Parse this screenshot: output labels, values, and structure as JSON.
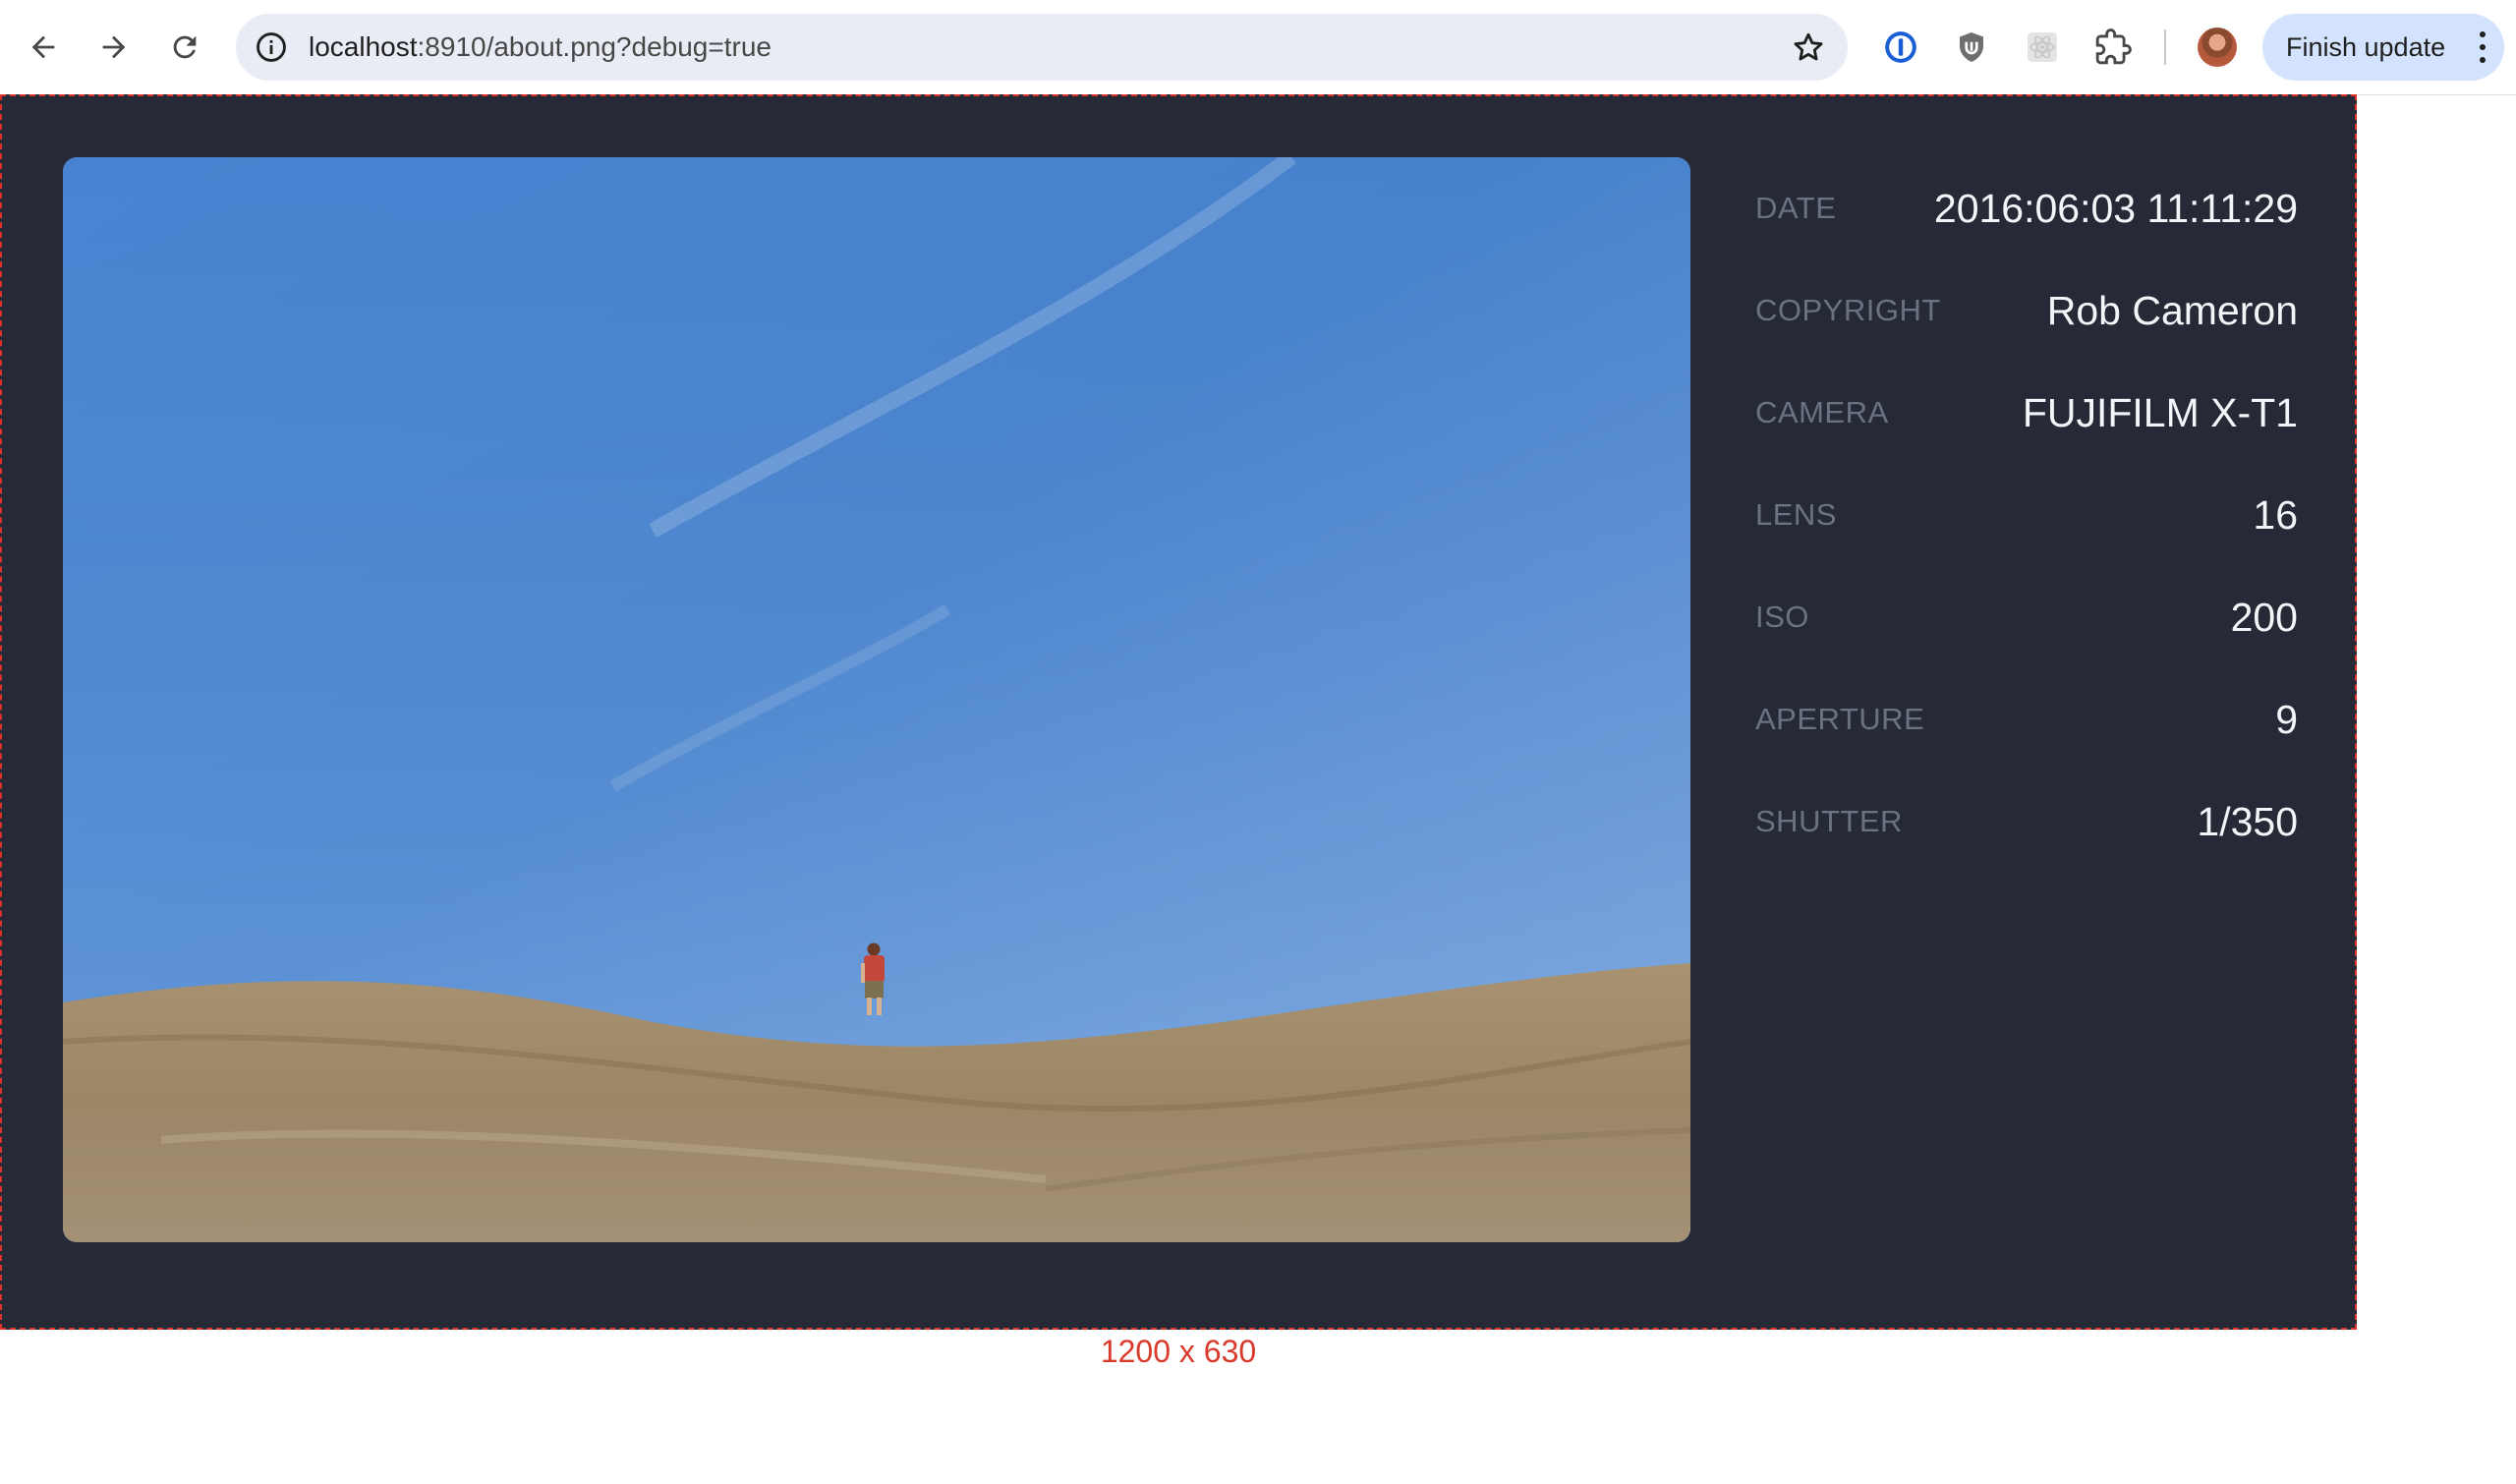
{
  "browser": {
    "url_host": "localhost",
    "url_rest": ":8910/about.png?debug=true",
    "update_label": "Finish update"
  },
  "card": {
    "rows": [
      {
        "key": "DATE",
        "value": "2016:06:03 11:11:29"
      },
      {
        "key": "COPYRIGHT",
        "value": "Rob Cameron"
      },
      {
        "key": "CAMERA",
        "value": "FUJIFILM X-T1"
      },
      {
        "key": "LENS",
        "value": "16"
      },
      {
        "key": "ISO",
        "value": "200"
      },
      {
        "key": "APERTURE",
        "value": "9"
      },
      {
        "key": "SHUTTER",
        "value": "1/350"
      }
    ]
  },
  "debug": {
    "dimensions": "1200 x 630"
  },
  "colors": {
    "card_bg": "#252a36",
    "debug_red": "#e0302b",
    "label_gray": "#6b7383",
    "value_white": "#f3f5f8"
  },
  "icons": [
    "back-arrow-icon",
    "forward-arrow-icon",
    "reload-icon",
    "info-icon",
    "star-icon",
    "onepassword-icon",
    "ublock-shield-icon",
    "react-devtools-icon",
    "extensions-puzzle-icon",
    "kebab-menu-icon"
  ]
}
